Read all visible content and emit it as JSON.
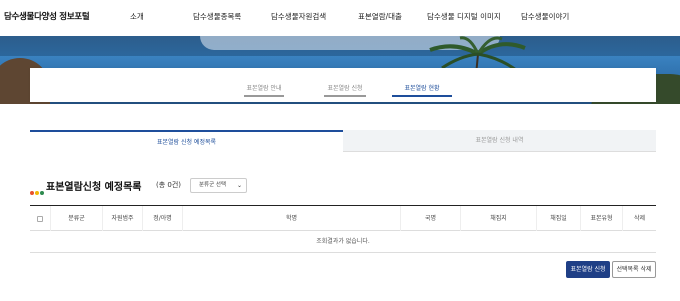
{
  "header": {
    "logo": "담수생물다양성 정보포털",
    "nav": [
      "소개",
      "담수생물종목록",
      "담수생물자원검색",
      "표본열람/대출",
      "담수생물 디지털 이미지",
      "담수생물이야기"
    ]
  },
  "subtabs": [
    {
      "label": "표본열람 안내",
      "active": false
    },
    {
      "label": "표본열람 신청",
      "active": false
    },
    {
      "label": "표본열람 현황",
      "active": true
    }
  ],
  "tabs": [
    {
      "label": "표본열람 신청 예정목록",
      "active": true
    },
    {
      "label": "표본열람 신청 내역",
      "active": false
    }
  ],
  "section": {
    "title": "표본열람신청 예정목록",
    "count_label": "(총 0건)",
    "filter": {
      "selected": "분류군 선택",
      "caret": "⌄"
    },
    "dot_colors": [
      "#e8522d",
      "#f2b705",
      "#2d8a4e"
    ]
  },
  "table": {
    "columns": [
      "분류군",
      "자원범주",
      "정/아명",
      "학명",
      "국명",
      "채집지",
      "채집일",
      "표본유형",
      "삭제"
    ],
    "empty_message": "조회결과가 없습니다."
  },
  "actions": {
    "apply": "표본열람 신청",
    "delete_selected": "선택목록 삭제"
  },
  "colors": {
    "accent": "#1e4e9b",
    "primary_button": "#1f3f86"
  }
}
